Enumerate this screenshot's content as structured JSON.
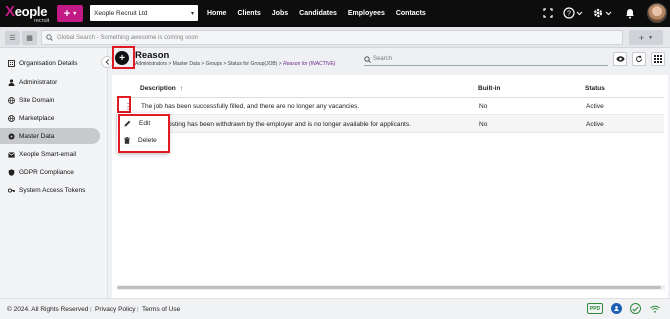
{
  "brand": {
    "name_main": "eople",
    "name_x": "X",
    "name_sub": "recruit",
    "accent": "#c21a85"
  },
  "topbar": {
    "add_label": "+",
    "add_caret": "▾",
    "company": "Xeople Recruit Ltd",
    "nav": [
      "Home",
      "Clients",
      "Jobs",
      "Candidates",
      "Employees",
      "Contacts"
    ],
    "icons": [
      "fullscreen-icon",
      "help-icon",
      "settings-icon",
      "bell-icon",
      "avatar"
    ]
  },
  "subbar": {
    "search_placeholder": "Global Search - Something awesome is coming soon",
    "add_label": "+"
  },
  "sidebar": {
    "items": [
      {
        "label": "Organisation Details",
        "icon": "building-icon"
      },
      {
        "label": "Administrator",
        "icon": "person-icon"
      },
      {
        "label": "Site Domain",
        "icon": "globe-icon"
      },
      {
        "label": "Marketplace",
        "icon": "globe-icon"
      },
      {
        "label": "Master Data",
        "icon": "database-icon",
        "active": true
      },
      {
        "label": "Xeople Smart-email",
        "icon": "mail-icon"
      },
      {
        "label": "GDPR Compliance",
        "icon": "shield-icon"
      },
      {
        "label": "System Access Tokens",
        "icon": "key-icon"
      }
    ]
  },
  "header": {
    "add_label": "+",
    "title": "Reason",
    "breadcrumb": "Administrators > Master Data > Groups > Status for Group(JOB) > ",
    "breadcrumb_current": "Reason for (INACTIVE)",
    "search_placeholder": "Search"
  },
  "table": {
    "columns": [
      "Description",
      "Built-in",
      "Status"
    ],
    "sort_indicator": "↑",
    "rows": [
      {
        "description": "The job has been successfully filled, and there are no longer any vacancies.",
        "builtin": "No",
        "status": "Active"
      },
      {
        "description": "The job posting has been withdrawn by the employer and is no longer available for applicants.",
        "builtin": "No",
        "status": "Active"
      }
    ]
  },
  "context_menu": {
    "items": [
      {
        "label": "Edit",
        "icon": "pencil-icon"
      },
      {
        "label": "Delete",
        "icon": "trash-icon"
      }
    ]
  },
  "footer": {
    "copyright": "© 2024. All Rights Reserved",
    "privacy": "Privacy Policy",
    "terms": "Terms of Use",
    "ppd": "PPD"
  }
}
